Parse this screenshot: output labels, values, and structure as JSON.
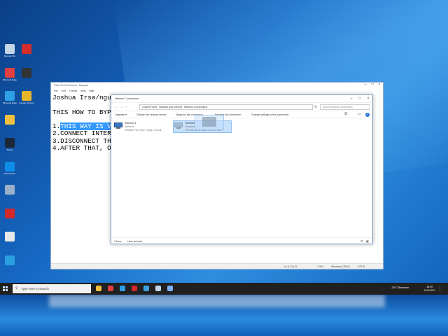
{
  "desktop": {
    "icons_left": [
      {
        "label": "Recycle Bin",
        "color": "#c6d6e8"
      },
      {
        "label": "Microsoft Edge",
        "color": "#e04040"
      },
      {
        "label": "Microsoft Edge",
        "color": "#2f9fe6"
      },
      {
        "label": "",
        "color": "#f0c040"
      },
      {
        "label": "Steam",
        "color": "#1b2838"
      },
      {
        "label": "TeamViewer",
        "color": "#0e8ee9"
      },
      {
        "label": "",
        "color": "#9ab0c8"
      },
      {
        "label": "",
        "color": "#d42a2a"
      },
      {
        "label": "",
        "color": "#e8e8e8"
      },
      {
        "label": "",
        "color": "#2aa0e0"
      }
    ],
    "icons_right": [
      {
        "label": "",
        "color": "#d72c2c"
      },
      {
        "label": "",
        "color": "#333333"
      },
      {
        "label": "Google Chrome",
        "color": "#e7b52a"
      }
    ]
  },
  "notepad": {
    "title": "*New Text Document - Notepad",
    "menu": [
      "File",
      "Edit",
      "Format",
      "View",
      "Help"
    ],
    "lines": [
      {
        "pre": "Joshua Irsa/nguyen",
        "hl": "",
        "post": ""
      },
      {
        "pre": "",
        "hl": "",
        "post": ""
      },
      {
        "pre": "THIS HOW TO BYPASS",
        "hl": "",
        "post": ""
      },
      {
        "pre": "",
        "hl": "",
        "post": ""
      },
      {
        "pre": "1.",
        "hl": "THIS WAY IS VERY",
        "post": ""
      },
      {
        "pre": "2.CONNECT INTERNET",
        "hl": "",
        "post": ""
      },
      {
        "pre": "3.DISCONNECT THE N",
        "hl": "",
        "post": ""
      },
      {
        "pre": "4.AFTER THAT, OPEN",
        "hl": "",
        "post": ""
      }
    ],
    "status": {
      "position": "Ln 5, Col 21",
      "zoom": "170%",
      "eol": "Windows (CRLF)",
      "encoding": "UTF-8"
    }
  },
  "network_window": {
    "title": "Network Connections",
    "path": "Control Panel  ›  Network and Internet  ›  Network Connections",
    "search_placeholder": "Search Network Connections",
    "commands": [
      "Organise ▾",
      "Disable this network device",
      "Diagnose this connection",
      "Rename this connection",
      "Change settings of this connection"
    ],
    "adapters": [
      {
        "name": "Ethernet 1",
        "status": "Network",
        "device": "Realtek PCIe GbE Family Controll..."
      },
      {
        "name": "Ethernet",
        "status": "Disabled",
        "device": "Remote NDIS based Internet Shar..."
      }
    ],
    "status_items": "2 items",
    "status_selected": "1 item selected"
  },
  "taskbar": {
    "search_placeholder": "Type here to search",
    "apps": [
      "#f0c040",
      "#e04040",
      "#2f9fe6",
      "#d42a2a",
      "#3aa0e0",
      "#c6d6e8",
      "#7db2f0"
    ],
    "weather": "25°C  Berawan",
    "time": "16:09",
    "date": "11/11/2021"
  }
}
